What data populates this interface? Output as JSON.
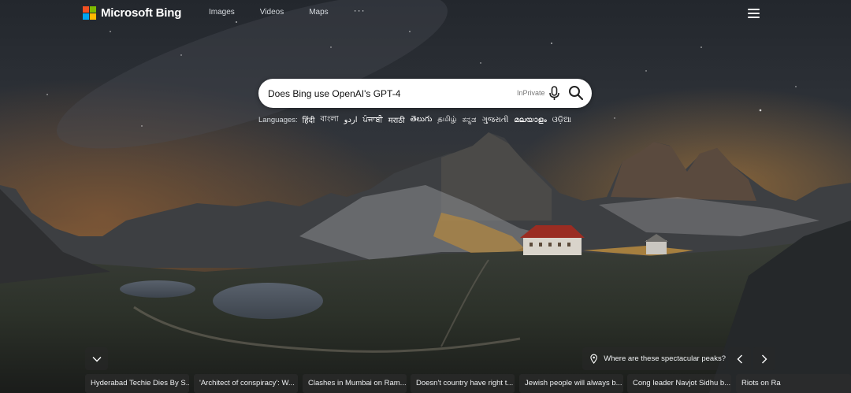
{
  "header": {
    "brand": "Microsoft Bing",
    "nav": [
      {
        "label": "Images"
      },
      {
        "label": "Videos"
      },
      {
        "label": "Maps"
      }
    ],
    "more_label": "···"
  },
  "search": {
    "query": "Does Bing use OpenAI's GPT-4",
    "inprivate_label": "InPrivate"
  },
  "languages": {
    "label": "Languages:",
    "items": [
      "हिंदी",
      "বাংলা",
      "اردو",
      "ਪੰਜਾਬੀ",
      "मराठी",
      "తెలుగు",
      "தமிழ்",
      "ಕನ್ನಡ",
      "ગુજરાતી",
      "മലയാളം",
      "ଓଡ଼ିଆ"
    ]
  },
  "image_info": {
    "location_question": "Where are these spectacular peaks?"
  },
  "news": [
    "Hyderabad Techie Dies By S...",
    "'Architect of conspiracy': W...",
    "Clashes in Mumbai on Ram...",
    "Doesn't country have right t...",
    "Jewish people will always b...",
    "Cong leader Navjot Sidhu b...",
    "Riots on Ra"
  ],
  "icons": {
    "mic": "microphone-icon",
    "search": "search-icon",
    "menu": "hamburger-menu-icon",
    "expand": "chevron-down-icon",
    "location": "location-pin-icon",
    "prev": "chevron-left-icon",
    "next": "chevron-right-icon"
  },
  "colors": {
    "logo_red": "#f25022",
    "logo_green": "#7fba00",
    "logo_blue": "#00a4ef",
    "logo_yellow": "#ffb900"
  }
}
